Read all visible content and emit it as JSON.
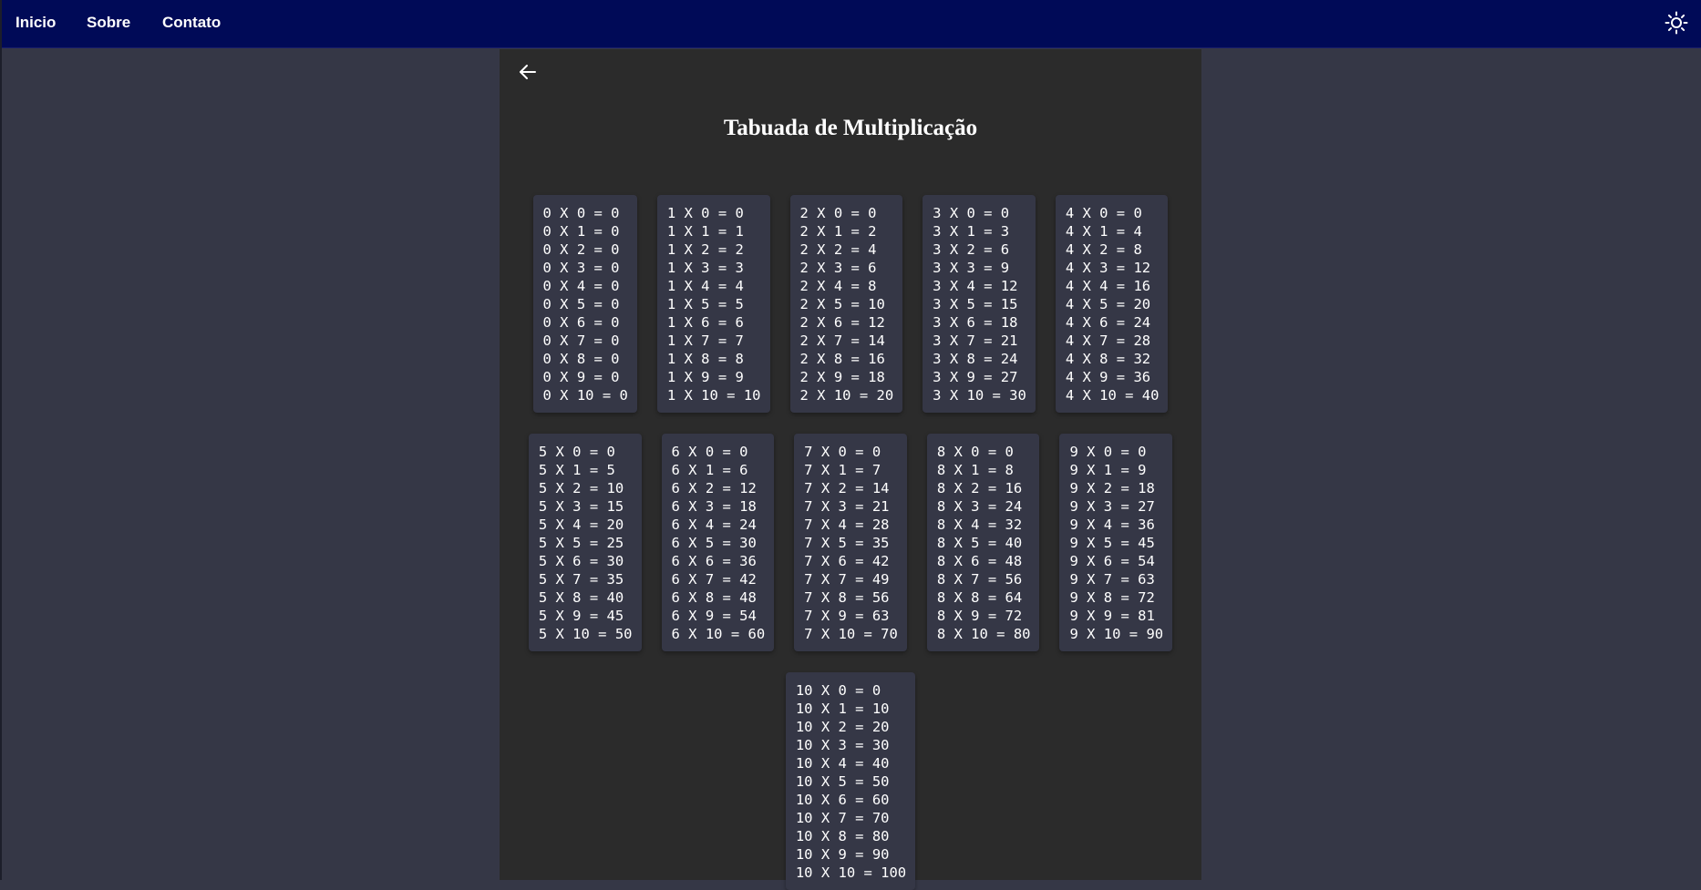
{
  "nav": {
    "links": [
      "Inicio",
      "Sobre",
      "Contato"
    ],
    "theme_toggle_icon": "sun-icon"
  },
  "colors": {
    "navbar": "#000a57",
    "page_background": "#353746",
    "content_background": "#2b2b2b",
    "card_background": "#353746",
    "text": "#ffffff"
  },
  "page": {
    "back_icon": "arrow-left-icon",
    "title": "Tabuada de Multiplicação"
  },
  "tables": [
    [
      "0 X 0 = 0",
      "0 X 1 = 0",
      "0 X 2 = 0",
      "0 X 3 = 0",
      "0 X 4 = 0",
      "0 X 5 = 0",
      "0 X 6 = 0",
      "0 X 7 = 0",
      "0 X 8 = 0",
      "0 X 9 = 0",
      "0 X 10 = 0"
    ],
    [
      "1 X 0 = 0",
      "1 X 1 = 1",
      "1 X 2 = 2",
      "1 X 3 = 3",
      "1 X 4 = 4",
      "1 X 5 = 5",
      "1 X 6 = 6",
      "1 X 7 = 7",
      "1 X 8 = 8",
      "1 X 9 = 9",
      "1 X 10 = 10"
    ],
    [
      "2 X 0 = 0",
      "2 X 1 = 2",
      "2 X 2 = 4",
      "2 X 3 = 6",
      "2 X 4 = 8",
      "2 X 5 = 10",
      "2 X 6 = 12",
      "2 X 7 = 14",
      "2 X 8 = 16",
      "2 X 9 = 18",
      "2 X 10 = 20"
    ],
    [
      "3 X 0 = 0",
      "3 X 1 = 3",
      "3 X 2 = 6",
      "3 X 3 = 9",
      "3 X 4 = 12",
      "3 X 5 = 15",
      "3 X 6 = 18",
      "3 X 7 = 21",
      "3 X 8 = 24",
      "3 X 9 = 27",
      "3 X 10 = 30"
    ],
    [
      "4 X 0 = 0",
      "4 X 1 = 4",
      "4 X 2 = 8",
      "4 X 3 = 12",
      "4 X 4 = 16",
      "4 X 5 = 20",
      "4 X 6 = 24",
      "4 X 7 = 28",
      "4 X 8 = 32",
      "4 X 9 = 36",
      "4 X 10 = 40"
    ],
    [
      "5 X 0 = 0",
      "5 X 1 = 5",
      "5 X 2 = 10",
      "5 X 3 = 15",
      "5 X 4 = 20",
      "5 X 5 = 25",
      "5 X 6 = 30",
      "5 X 7 = 35",
      "5 X 8 = 40",
      "5 X 9 = 45",
      "5 X 10 = 50"
    ],
    [
      "6 X 0 = 0",
      "6 X 1 = 6",
      "6 X 2 = 12",
      "6 X 3 = 18",
      "6 X 4 = 24",
      "6 X 5 = 30",
      "6 X 6 = 36",
      "6 X 7 = 42",
      "6 X 8 = 48",
      "6 X 9 = 54",
      "6 X 10 = 60"
    ],
    [
      "7 X 0 = 0",
      "7 X 1 = 7",
      "7 X 2 = 14",
      "7 X 3 = 21",
      "7 X 4 = 28",
      "7 X 5 = 35",
      "7 X 6 = 42",
      "7 X 7 = 49",
      "7 X 8 = 56",
      "7 X 9 = 63",
      "7 X 10 = 70"
    ],
    [
      "8 X 0 = 0",
      "8 X 1 = 8",
      "8 X 2 = 16",
      "8 X 3 = 24",
      "8 X 4 = 32",
      "8 X 5 = 40",
      "8 X 6 = 48",
      "8 X 7 = 56",
      "8 X 8 = 64",
      "8 X 9 = 72",
      "8 X 10 = 80"
    ],
    [
      "9 X 0 = 0",
      "9 X 1 = 9",
      "9 X 2 = 18",
      "9 X 3 = 27",
      "9 X 4 = 36",
      "9 X 5 = 45",
      "9 X 6 = 54",
      "9 X 7 = 63",
      "9 X 8 = 72",
      "9 X 9 = 81",
      "9 X 10 = 90"
    ],
    [
      "10 X 0 = 0",
      "10 X 1 = 10",
      "10 X 2 = 20",
      "10 X 3 = 30",
      "10 X 4 = 40",
      "10 X 5 = 50",
      "10 X 6 = 60",
      "10 X 7 = 70",
      "10 X 8 = 80",
      "10 X 9 = 90",
      "10 X 10 = 100"
    ]
  ]
}
